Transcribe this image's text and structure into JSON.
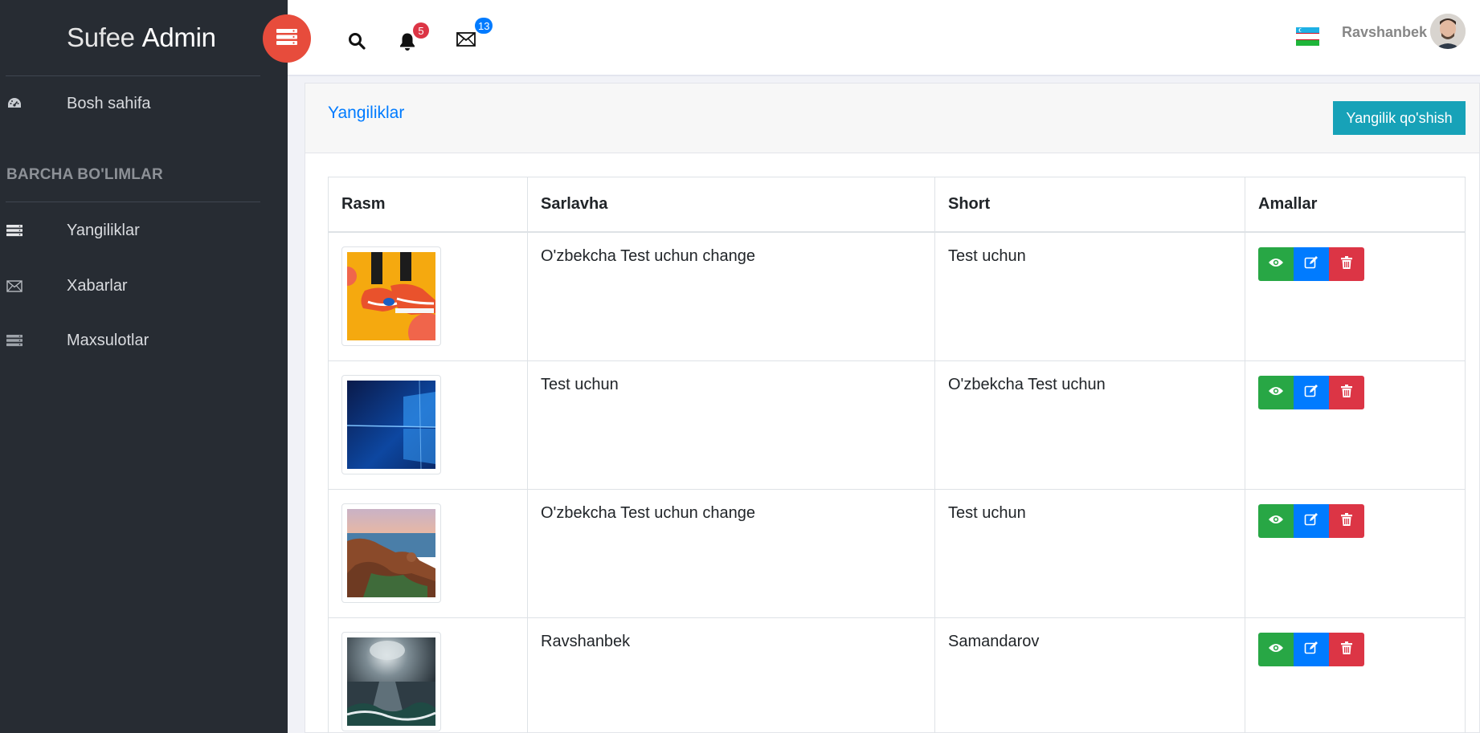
{
  "brand": {
    "light": "Sufee",
    "bold": "Admin"
  },
  "sidebar": {
    "home": {
      "label": "Bosh sahifa",
      "icon": "dashboard-icon"
    },
    "heading": "BARCHA BO'LIMLAR",
    "items": [
      {
        "label": "Yangiliklar",
        "icon": "list-icon"
      },
      {
        "label": "Xabarlar",
        "icon": "envelope-icon"
      },
      {
        "label": "Maxsulotlar",
        "icon": "list-icon"
      }
    ]
  },
  "header": {
    "notifications_count": "5",
    "messages_count": "13",
    "user_name": "Ravshanbek",
    "language_flag": "uzbekistan-flag"
  },
  "main": {
    "title": "Yangiliklar",
    "add_button": "Yangilik qo'shish",
    "columns": [
      "Rasm",
      "Sarlavha",
      "Short",
      "Amallar"
    ],
    "rows": [
      {
        "image": "sneaker-image",
        "title": "O'zbekcha Test uchun change",
        "short": "Test uchun"
      },
      {
        "image": "windows-image",
        "title": "Test uchun",
        "short": "O'zbekcha Test uchun"
      },
      {
        "image": "coast-image",
        "title": "O'zbekcha Test uchun change",
        "short": "Test uchun"
      },
      {
        "image": "sea-storm-image",
        "title": "Ravshanbek",
        "short": "Samandarov"
      }
    ]
  },
  "colors": {
    "sidebar_bg": "#272c33",
    "toggle": "#e74c3c",
    "primary": "#007bff",
    "info": "#17a2b8",
    "success": "#28a745",
    "danger": "#dc3545"
  }
}
